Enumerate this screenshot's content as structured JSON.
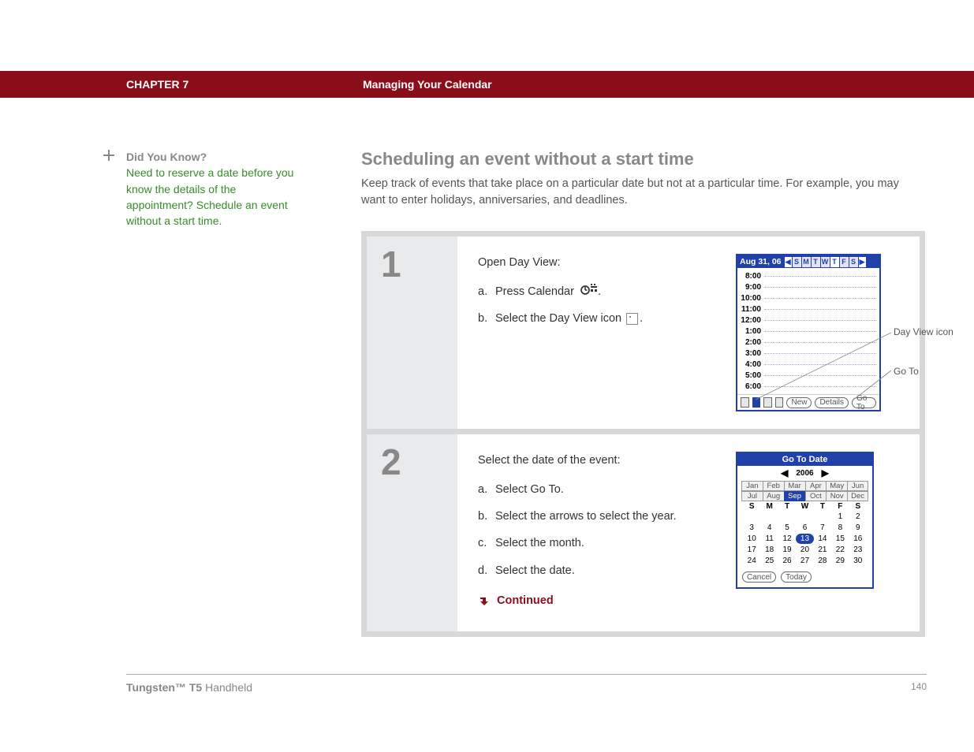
{
  "header": {
    "chapter_label": "CHAPTER 7",
    "chapter_title": "Managing Your Calendar"
  },
  "aside": {
    "dyk_title": "Did You Know?",
    "dyk_text": "Need to reserve a date before you know the details of the appointment? Schedule an event without a start time."
  },
  "main": {
    "heading": "Scheduling an event without a start time",
    "intro": "Keep track of events that take place on a particular date but not at a particular time. For example, you may want to enter holidays, anniversaries, and deadlines."
  },
  "step1": {
    "number": "1",
    "lead": "Open Day View:",
    "a_label": "a.",
    "a_text": "Press Calendar",
    "a_suffix": ".",
    "b_label": "b.",
    "b_text": "Select the Day View icon",
    "b_suffix": ".",
    "callout_dayview": "Day View icon",
    "callout_goto": "Go To",
    "palm": {
      "date": "Aug 31, 06",
      "dow": [
        "S",
        "M",
        "T",
        "W",
        "T",
        "F",
        "S"
      ],
      "hours": [
        "8:00",
        "9:00",
        "10:00",
        "11:00",
        "12:00",
        "1:00",
        "2:00",
        "3:00",
        "4:00",
        "5:00",
        "6:00"
      ],
      "btn_new": "New",
      "btn_details": "Details",
      "btn_goto": "Go To"
    }
  },
  "step2": {
    "number": "2",
    "lead": "Select the date of the event:",
    "a_label": "a.",
    "a_text": "Select Go To.",
    "b_label": "b.",
    "b_text": "Select the arrows to select the year.",
    "c_label": "c.",
    "c_text": "Select the month.",
    "d_label": "d.",
    "d_text": "Select the date.",
    "continued": "Continued",
    "goto": {
      "title": "Go To Date",
      "year": "2006",
      "months": [
        "Jan",
        "Feb",
        "Mar",
        "Apr",
        "May",
        "Jun",
        "Jul",
        "Aug",
        "Sep",
        "Oct",
        "Nov",
        "Dec"
      ],
      "selected_month": "Sep",
      "selected_day": "13",
      "dow_head": [
        "S",
        "M",
        "T",
        "W",
        "T",
        "F",
        "S"
      ],
      "weeks": [
        [
          "",
          "",
          "",
          "",
          "",
          "1",
          "2"
        ],
        [
          "3",
          "4",
          "5",
          "6",
          "7",
          "8",
          "9"
        ],
        [
          "10",
          "11",
          "12",
          "13",
          "14",
          "15",
          "16"
        ],
        [
          "17",
          "18",
          "19",
          "20",
          "21",
          "22",
          "23"
        ],
        [
          "24",
          "25",
          "26",
          "27",
          "28",
          "29",
          "30"
        ]
      ],
      "btn_cancel": "Cancel",
      "btn_today": "Today"
    }
  },
  "footer": {
    "product_bold": "Tungsten™ T5",
    "product_rest": " Handheld",
    "page": "140"
  }
}
